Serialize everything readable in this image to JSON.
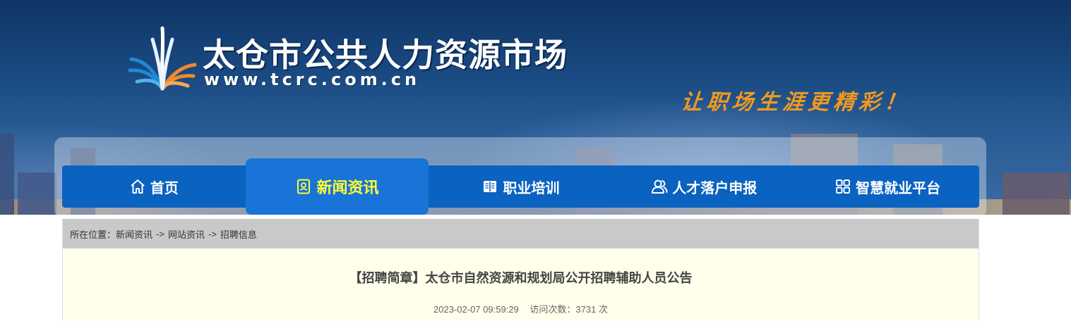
{
  "header": {
    "site_title": "太仓市公共人力资源市场",
    "site_url": "www.tcrc.com.cn",
    "slogan": "让职场生涯更精彩！",
    "logo_icon": "fan-logo-icon"
  },
  "nav": {
    "items": [
      {
        "label": "首页",
        "icon": "home-icon"
      },
      {
        "label": "新闻资讯",
        "icon": "news-icon",
        "active": true
      },
      {
        "label": "职业培训",
        "icon": "book-icon"
      },
      {
        "label": "人才落户申报",
        "icon": "users-icon"
      },
      {
        "label": "智慧就业平台",
        "icon": "grid-icon"
      }
    ],
    "active_color": "#ffff33",
    "bar_color": "#0a62c1"
  },
  "breadcrumb": {
    "prefix": "所在位置：",
    "items": [
      "新闻资讯",
      "网站资讯",
      "招聘信息"
    ],
    "separator": "->"
  },
  "article": {
    "title": "【招聘简章】太仓市自然资源和规划局公开招聘辅助人员公告",
    "datetime": "2023-02-07 09:59:29",
    "visits_label": "访问次数：",
    "visits": "3731",
    "visits_unit": "次"
  }
}
